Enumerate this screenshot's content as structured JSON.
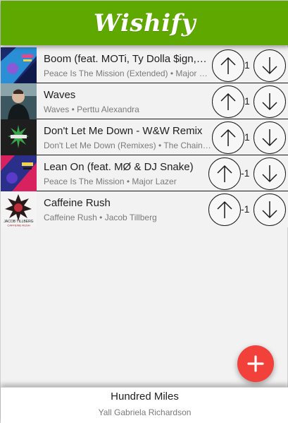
{
  "app": {
    "title": "Wishify",
    "brand_color": "#5fa800",
    "fab_color": "#f2403a"
  },
  "songs": [
    {
      "title": "Boom (feat. MOTi, Ty Dolla $ign, Wizkid & Kranium)",
      "subtitle": "Peace Is The Mission (Extended) • Major Lazer",
      "votes": "1",
      "art": "album-art-peace-is-the-mission"
    },
    {
      "title": "Waves",
      "subtitle": "Waves • Perttu Alexandra",
      "votes": "1",
      "art": "album-art-waves"
    },
    {
      "title": "Don't Let Me Down - W&W Remix",
      "subtitle": "Don't Let Me Down (Remixes) • The Chainsmokers",
      "votes": "1",
      "art": "album-art-dont-let-me-down"
    },
    {
      "title": "Lean On (feat. MØ & DJ Snake)",
      "subtitle": "Peace Is The Mission • Major Lazer",
      "votes": "-1",
      "art": "album-art-peace-is-the-mission"
    },
    {
      "title": "Caffeine Rush",
      "subtitle": "Caffeine Rush • Jacob Tillberg",
      "votes": "-1",
      "art": "album-art-caffeine-rush",
      "art_text": [
        "JACOB TILLBERG",
        "CAFFEINE RUSH"
      ]
    }
  ],
  "icons": {
    "upvote": "arrow-up-icon",
    "downvote": "arrow-down-icon",
    "add": "plus-icon"
  },
  "now_playing": {
    "title": "Hundred Miles",
    "artist": "Yall Gabriela Richardson"
  }
}
